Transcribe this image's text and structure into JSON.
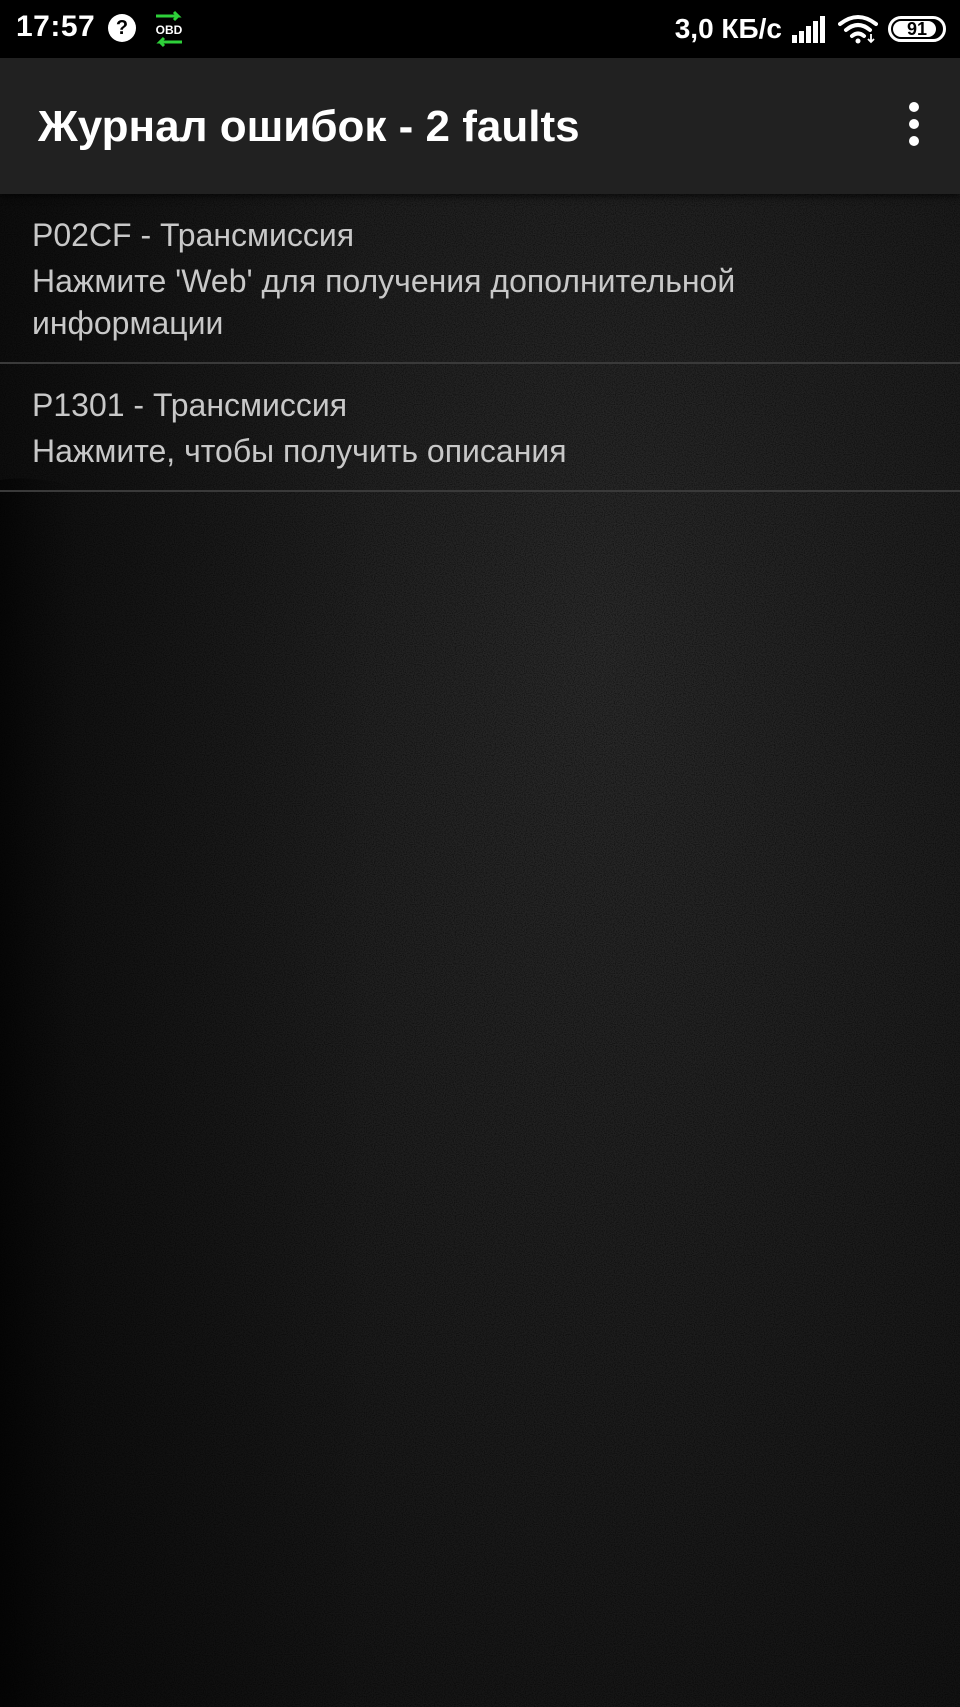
{
  "status_bar": {
    "time": "17:57",
    "help_glyph": "?",
    "obd_label": "OBD",
    "net_speed": "3,0 КБ/с",
    "battery_level": "91",
    "battery_fraction": 0.91,
    "icons": [
      "help-icon",
      "obd-icon",
      "signal-icon",
      "wifi-icon",
      "battery-icon"
    ]
  },
  "app_bar": {
    "title": "Журнал ошибок - 2 faults",
    "menu_icon": "more-vert-icon"
  },
  "faults": [
    {
      "code": "P02CF - Трансмиссия",
      "description": "Нажмите 'Web' для получения дополнительной информации"
    },
    {
      "code": "P1301 - Трансмиссия",
      "description": "Нажмите, чтобы получить описания"
    }
  ],
  "colors": {
    "status_bar_bg": "#000000",
    "app_bar_bg": "#212121",
    "text_secondary": "#c8c8c8",
    "obd_green": "#2ed03a",
    "divider": "#3a3a3a"
  }
}
